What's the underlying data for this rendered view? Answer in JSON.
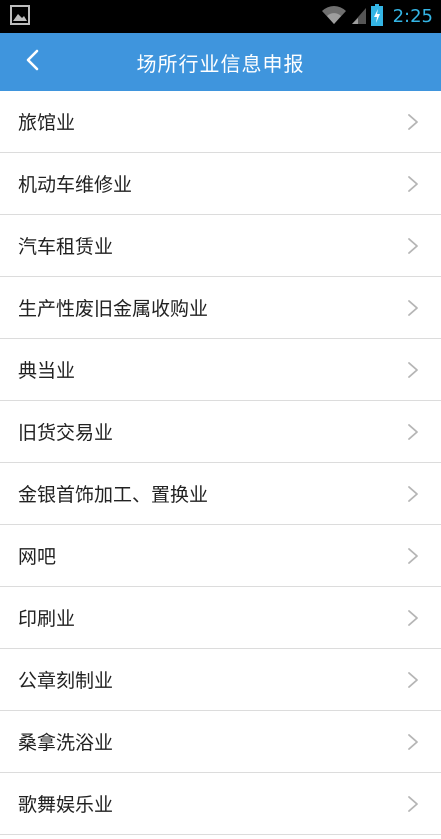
{
  "statusbar": {
    "time": "2:25",
    "icons": [
      "image-notification-icon",
      "wifi-icon",
      "signal-icon",
      "battery-charging-icon"
    ],
    "time_color": "#34b5e5"
  },
  "appbar": {
    "title": "场所行业信息申报",
    "back_icon": "chevron-left-icon",
    "background": "#3f95dd"
  },
  "list": {
    "items": [
      {
        "label": "旅馆业"
      },
      {
        "label": "机动车维修业"
      },
      {
        "label": "汽车租赁业"
      },
      {
        "label": "生产性废旧金属收购业"
      },
      {
        "label": "典当业"
      },
      {
        "label": "旧货交易业"
      },
      {
        "label": "金银首饰加工、置换业"
      },
      {
        "label": "网吧"
      },
      {
        "label": "印刷业"
      },
      {
        "label": "公章刻制业"
      },
      {
        "label": "桑拿洗浴业"
      },
      {
        "label": "歌舞娱乐业"
      }
    ],
    "chevron_icon": "chevron-right-icon"
  }
}
